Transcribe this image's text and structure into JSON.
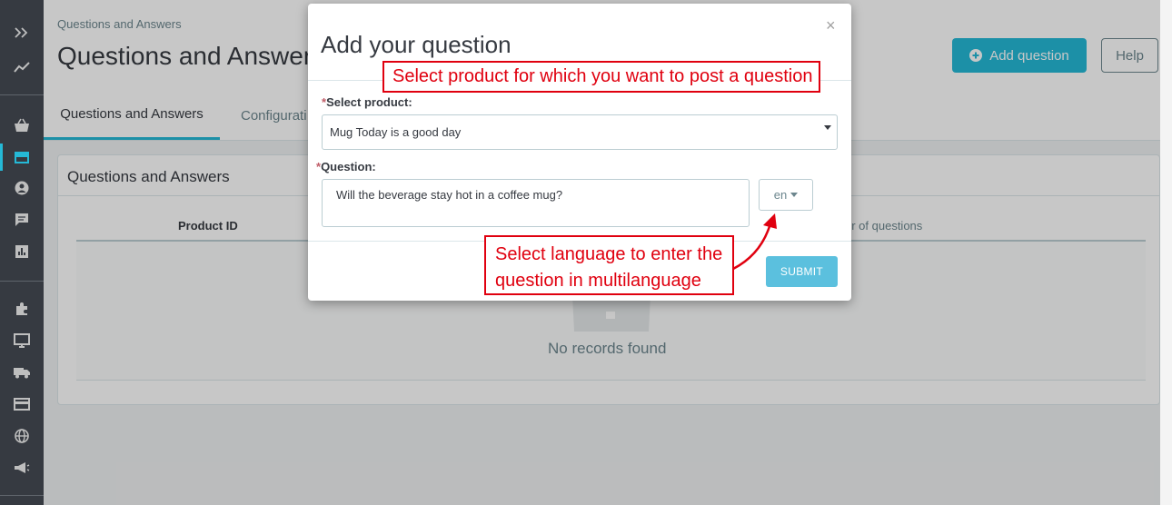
{
  "sidebar": {
    "icons": [
      "expand-icon",
      "dashboard-icon",
      "orders-icon",
      "catalog-icon",
      "customers-icon",
      "messages-icon",
      "stats-icon",
      "modules-icon",
      "design-icon",
      "shipping-icon",
      "payment-icon",
      "international-icon",
      "marketing-icon"
    ]
  },
  "header": {
    "breadcrumb": "Questions and Answers",
    "title": "Questions and Answers",
    "add_button": "Add question",
    "help_button": "Help"
  },
  "tabs": [
    {
      "label": "Questions and Answers",
      "active": true
    },
    {
      "label": "Configurati",
      "active": false
    }
  ],
  "panel": {
    "title": "Questions and Answers",
    "columns": [
      "Product ID",
      "er of questions"
    ],
    "empty_text": "No records found"
  },
  "modal": {
    "title": "Add your question",
    "close": "×",
    "select_label": "Select product:",
    "select_value": "Mug Today is a good day",
    "question_label": "Question:",
    "question_value": "Will the beverage stay hot in a coffee mug?",
    "language": "en",
    "submit": "SUBMIT",
    "required_mark": "*"
  },
  "annotations": {
    "product_hint": "Select product for which you want to post a question",
    "language_hint_line1": "Select language to enter the",
    "language_hint_line2": "question in multilanguage"
  },
  "colors": {
    "accent": "#25b9d7",
    "sidebar": "#363a41",
    "annotation": "#e0000f",
    "submit": "#5bc0de"
  }
}
